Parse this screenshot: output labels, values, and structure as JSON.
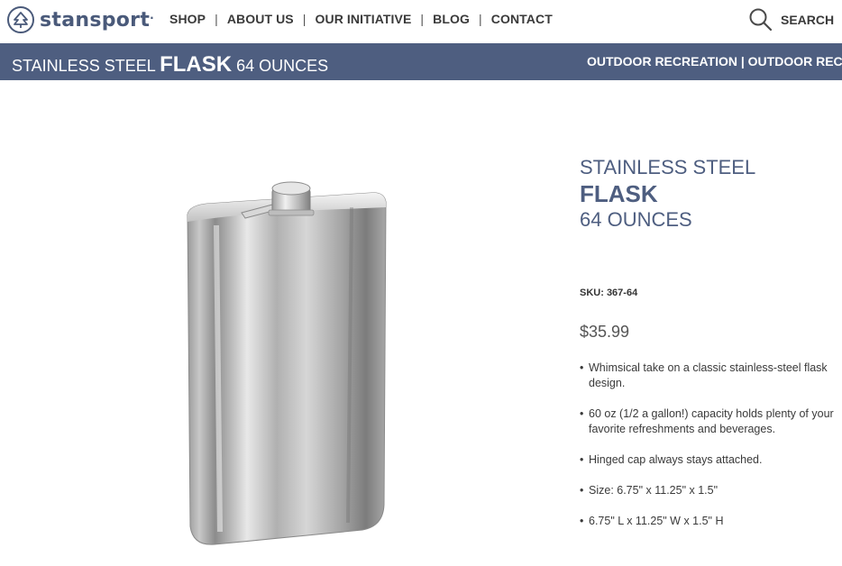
{
  "brand": {
    "name": "stansport",
    "reg": "."
  },
  "nav": {
    "items": [
      "SHOP",
      "ABOUT US",
      "OUR INITIATIVE",
      "BLOG",
      "CONTACT"
    ],
    "separator": "|"
  },
  "search": {
    "label": "SEARCH",
    "icon": "search-icon"
  },
  "titlebar": {
    "part1": "STAINLESS STEEL ",
    "part2": "FLASK",
    "part3": " 64 OUNCES",
    "category": "OUTDOOR RECREATION | OUTDOOR RECREATION"
  },
  "product": {
    "title_line1": "STAINLESS STEEL",
    "title_line2": "FLASK",
    "title_line3": "64 OUNCES",
    "sku": "SKU: 367-64",
    "price": "$35.99",
    "bullets": [
      "Whimsical take on a classic stainless-steel flask design.",
      "60 oz (1/2 a gallon!) capacity holds plenty of your favorite refreshments and beverages.",
      "Hinged cap always stays attached.",
      "Size: 6.75\" x 11.25\" x 1.5\"",
      "6.75\" L x 11.25\" W x 1.5\" H"
    ]
  },
  "colors": {
    "brand": "#4e5e80",
    "text": "#3a3a3a"
  }
}
